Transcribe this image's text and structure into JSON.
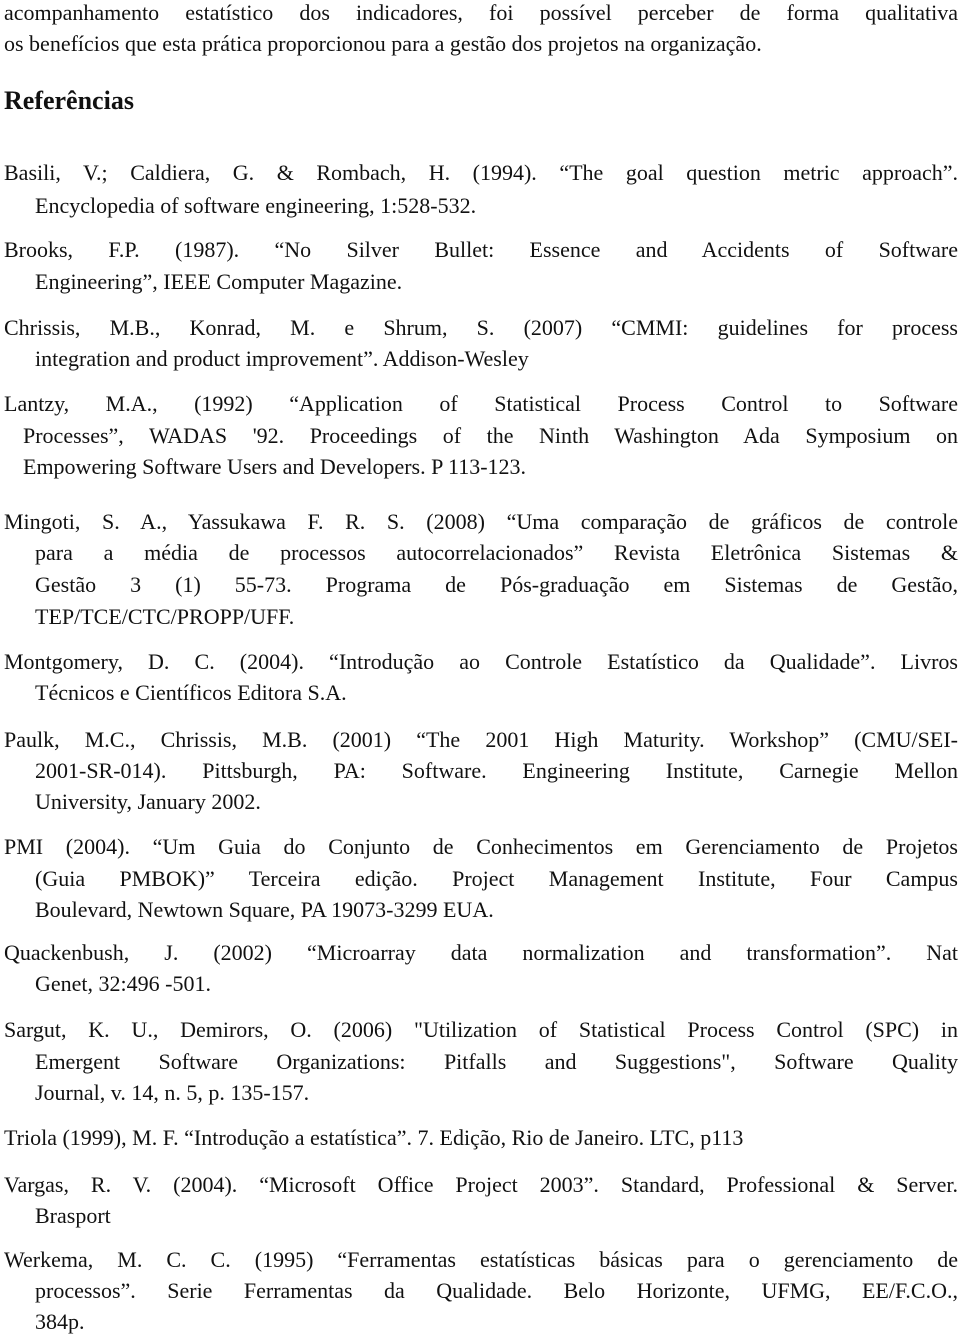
{
  "intro": {
    "lines": [
      "acompanhamento estatístico dos indicadores, foi possível perceber de forma qualitativa",
      "os benefícios que esta prática proporcionou para a gestão dos projetos na organização."
    ]
  },
  "references": {
    "heading": "Referências",
    "entries": [
      {
        "lines": [
          "Basili, V.; Caldiera, G. & Rombach, H. (1994). “The goal question metric approach”.",
          "Encyclopedia of software engineering, 1:528-532."
        ]
      },
      {
        "lines": [
          "Brooks, F.P. (1987). “No Silver Bullet: Essence and Accidents of Software",
          "Engineering”, IEEE Computer Magazine."
        ]
      },
      {
        "lines": [
          "Chrissis, M.B., Konrad, M. e Shrum, S. (2007) “CMMI: guidelines for process",
          "integration and product improvement”. Addison-Wesley"
        ]
      },
      {
        "lines": [
          "Lantzy, M.A., (1992) “Application of Statistical Process Control to Software",
          "Processes”,  WADAS '92. Proceedings of the Ninth Washington Ada Symposium on",
          "Empowering Software Users and Developers.  P 113-123."
        ]
      },
      {
        "lines": [
          "Mingoti, S. A., Yassukawa  F. R. S. (2008) “Uma comparação de gráficos de controle",
          "para a média de processos autocorrelacionados” Revista Eletrônica Sistemas &",
          "Gestão 3 (1) 55-73. Programa de Pós-graduação em Sistemas de Gestão,",
          "TEP/TCE/CTC/PROPP/UFF."
        ]
      },
      {
        "lines": [
          "Montgomery, D. C. (2004). “Introdução ao Controle Estatístico da Qualidade”. Livros",
          "Técnicos e Científicos Editora S.A."
        ]
      },
      {
        "lines": [
          "Paulk, M.C., Chrissis, M.B. (2001) “The 2001 High Maturity. Workshop” (CMU/SEI-",
          "2001-SR-014). Pittsburgh, PA: Software. Engineering Institute, Carnegie Mellon",
          "University, January 2002."
        ]
      },
      {
        "lines": [
          "PMI (2004). “Um Guia do Conjunto de Conhecimentos em Gerenciamento de Projetos",
          "(Guia PMBOK)” Terceira edição. Project Management Institute, Four Campus",
          "Boulevard, Newtown Square, PA 19073-3299 EUA."
        ]
      },
      {
        "lines": [
          "Quackenbush,  J. (2002) “Microarray data normalization and transformation”.  Nat",
          "Genet, 32:496 -501."
        ]
      },
      {
        "lines": [
          "Sargut, K. U., Demirors, O. (2006) \"Utilization of Statistical Process Control (SPC) in",
          "Emergent Software Organizations: Pitfalls and Suggestions\", Software Quality",
          "Journal, v. 14, n. 5, p. 135-157."
        ]
      },
      {
        "lines": [
          "Triola (1999), M. F. “Introdução a estatística”. 7. Edição, Rio de Janeiro. LTC, p113"
        ]
      },
      {
        "lines": [
          "Vargas, R. V. (2004). “Microsoft Office Project 2003”. Standard, Professional & Server.",
          "Brasport"
        ]
      },
      {
        "lines": [
          "Werkema, M. C. C. (1995) “Ferramentas estatísticas básicas para o gerenciamento de",
          "processos”. Serie Ferramentas da Qualidade. Belo Horizonte, UFMG, EE/F.C.O.,",
          "384p."
        ]
      }
    ]
  }
}
